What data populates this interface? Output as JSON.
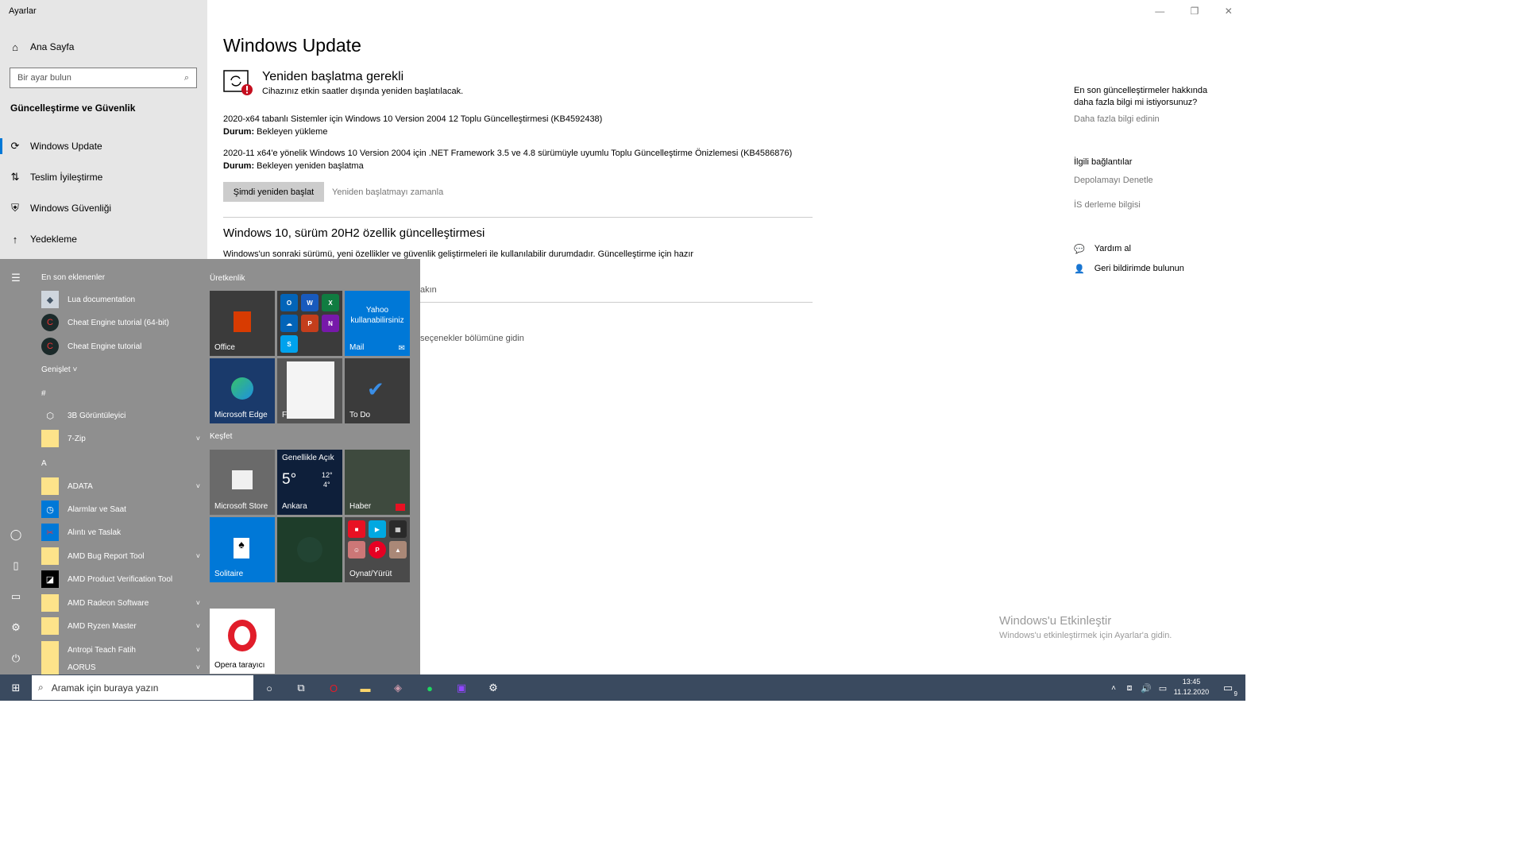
{
  "window": {
    "title": "Ayarlar"
  },
  "sidebar": {
    "home": "Ana Sayfa",
    "search_placeholder": "Bir ayar bulun",
    "section": "Güncelleştirme ve Güvenlik",
    "items": [
      {
        "label": "Windows Update",
        "icon": "refresh-icon"
      },
      {
        "label": "Teslim İyileştirme",
        "icon": "delivery-icon"
      },
      {
        "label": "Windows Güvenliği",
        "icon": "shield-icon"
      },
      {
        "label": "Yedekleme",
        "icon": "upload-icon"
      }
    ]
  },
  "main": {
    "title": "Windows Update",
    "restart_title": "Yeniden başlatma gerekli",
    "restart_sub": "Cihazınız etkin saatler dışında yeniden başlatılacak.",
    "updates": [
      {
        "name": "2020-x64 tabanlı Sistemler için Windows 10 Version 2004 12 Toplu Güncelleştirmesi (KB4592438)",
        "status_label": "Durum:",
        "status": "Bekleyen yükleme"
      },
      {
        "name": "2020-11 x64'e yönelik Windows 10 Version 2004 için .NET Framework 3.5 ve 4.8 sürümüyle uyumlu Toplu Güncelleştirme Önizlemesi (KB4586876)",
        "status_label": "Durum:",
        "status": "Bekleyen yeniden başlatma"
      }
    ],
    "restart_now": "Şimdi yeniden başlat",
    "schedule": "Yeniden başlatmayı zamanla",
    "feature_title": "Windows 10, sürüm 20H2 özellik güncelleştirmesi",
    "feature_desc": "Windows'un sonraki sürümü, yeni özellikler ve güvenlik geliştirmeleri ile kullanılabilir durumdadır. Güncelleştirme için hazır",
    "frag1": "akın",
    "frag2": "seçenekler bölümüne gidin"
  },
  "right": {
    "q1": "En son güncelleştirmeler hakkında",
    "q2": "daha fazla bilgi mi istiyorsunuz?",
    "learn": "Daha fazla bilgi edinin",
    "related": "İlgili bağlantılar",
    "storage": "Depolamayı Denetle",
    "build": "İS derleme bilgisi",
    "help": "Yardım al",
    "feedback": "Geri bildirimde bulunun"
  },
  "watermark": {
    "line1": "Windows'u Etkinleştir",
    "line2": "Windows'u etkinleştirmek için Ayarlar'a gidin."
  },
  "start": {
    "recent": "En son eklenenler",
    "recent_apps": [
      "Lua documentation",
      "Cheat Engine tutorial (64-bit)",
      "Cheat Engine tutorial"
    ],
    "expand": "Genişlet",
    "hash": "#",
    "apps_hash": [
      "3B Görüntüleyici",
      "7-Zip"
    ],
    "letter_a": "A",
    "apps_a": [
      "ADATA",
      "Alarmlar ve Saat",
      "Alıntı ve Taslak",
      "AMD Bug Report Tool",
      "AMD Product Verification Tool",
      "AMD Radeon Software",
      "AMD Ryzen Master",
      "Antropi Teach Fatih",
      "AORUS"
    ],
    "group1": "Üretkenlik",
    "group2": "Keşfet",
    "tiles": {
      "office": "Office",
      "mail": "Mail",
      "yahoo": "Yahoo kullanabilirsiniz",
      "edge": "Microsoft Edge",
      "photos": "F",
      "todo": "To Do",
      "store": "Microsoft Store",
      "weather_cond": "Genellikle Açık",
      "weather_temp": "5°",
      "weather_hi": "12°",
      "weather_lo": "4°",
      "weather_city": "Ankara",
      "news": "Haber",
      "solitaire": "Solitaire",
      "play": "Oynat/Yürüt",
      "opera": "Opera tarayıcı"
    }
  },
  "taskbar": {
    "search": "Aramak için buraya yazın",
    "time": "13:45",
    "date": "11.12.2020",
    "notif": "9"
  }
}
